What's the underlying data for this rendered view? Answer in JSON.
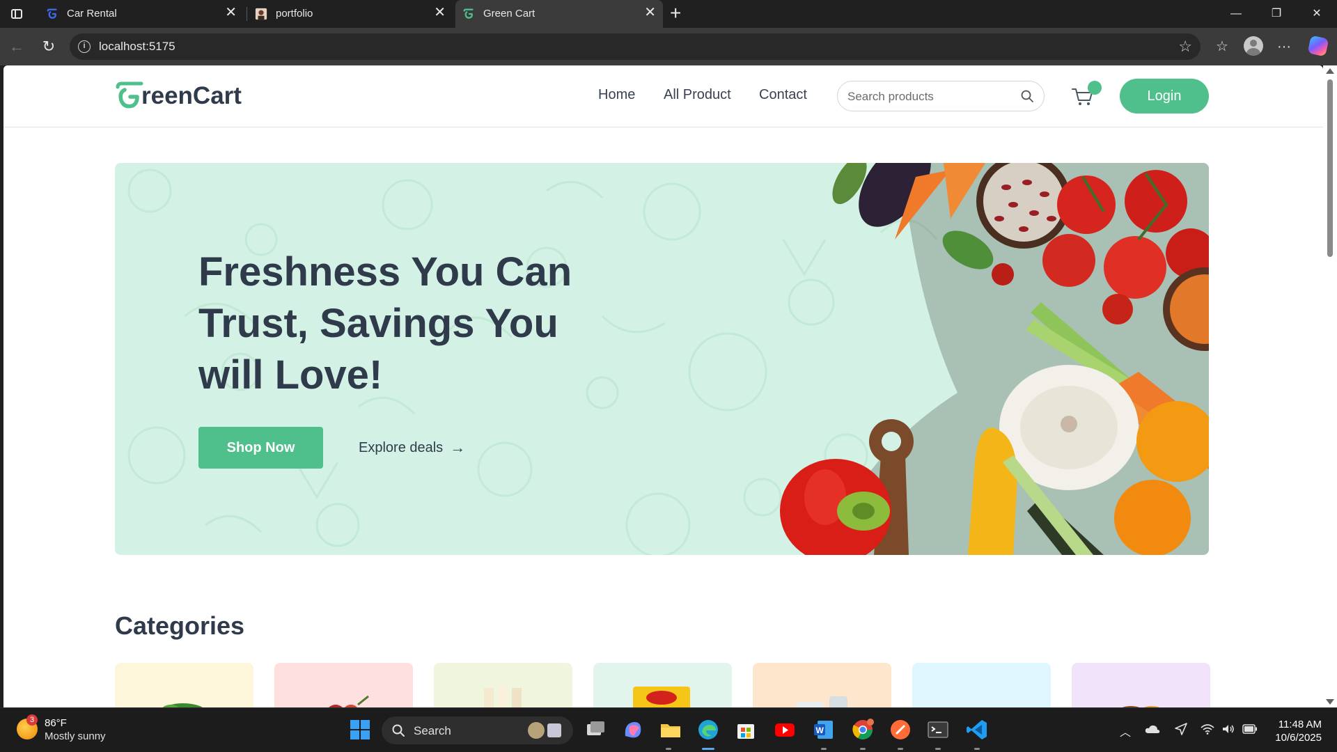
{
  "browser": {
    "tabs": [
      {
        "label": "Car Rental"
      },
      {
        "label": "portfolio"
      },
      {
        "label": "Green Cart"
      }
    ],
    "url": "localhost:5175"
  },
  "site": {
    "logo_text": "reenCart",
    "nav": {
      "home": "Home",
      "all_product": "All Product",
      "contact": "Contact"
    },
    "search_placeholder": "Search products",
    "login_label": "Login",
    "hero": {
      "title_lines": [
        "Freshness You Can",
        "Trust, Savings You",
        "will Love!"
      ],
      "shop_now": "Shop Now",
      "explore": "Explore deals"
    },
    "categories_title": "Categories",
    "category_colors": [
      "#fef6da",
      "#fee0e0",
      "#f0f5de",
      "#e1f5ec",
      "#fee6cd",
      "#e0f6fe",
      "#f1e3f9"
    ],
    "brand_color": "#4fbf8b"
  },
  "taskbar": {
    "weather_temp": "86°F",
    "weather_cond": "Mostly sunny",
    "weather_badge": "3",
    "search_label": "Search",
    "time": "11:48 AM",
    "date": "10/6/2025"
  }
}
